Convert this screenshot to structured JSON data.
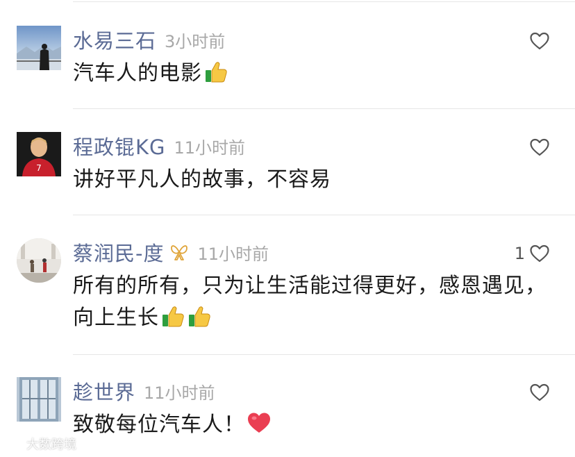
{
  "comments": [
    {
      "username": "水易三石",
      "time": "3小时前",
      "text": "汽车人的电影",
      "emoji": [
        "thumbs-up"
      ],
      "likes": ""
    },
    {
      "username": "程政锟KG",
      "time": "11小时前",
      "text": "讲好平凡人的故事，不容易",
      "emoji": [],
      "likes": ""
    },
    {
      "username": "蔡润民-度",
      "time": "11小时前",
      "text": "所有的所有，只为让生活能过得更好，感恩遇见，向上生长",
      "emoji": [
        "thumbs-up",
        "thumbs-up"
      ],
      "likes": "1",
      "badge_icon": "vip-ribbon-icon"
    },
    {
      "username": "趁世界",
      "time": "11小时前",
      "text": "致敬每位汽车人！",
      "emoji": [
        "red-heart"
      ],
      "likes": ""
    }
  ],
  "watermark": {
    "text": "大数跨境",
    "logo": "sheep-logo"
  },
  "colors": {
    "username": "#5b6b95",
    "time": "#a8a8a8",
    "text": "#1a1a1a",
    "divider": "#e6e6e6"
  }
}
